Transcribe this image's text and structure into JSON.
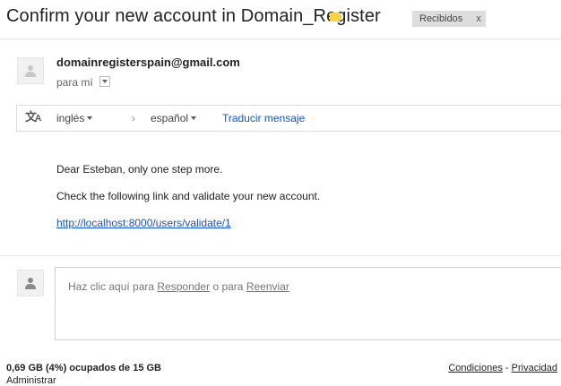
{
  "email": {
    "subject": "Confirm your new account in Domain_Register",
    "label_color": "#f8d24a",
    "inbox_chip": {
      "label": "Recibidos",
      "remove_symbol": "x"
    },
    "sender": "domainregisterspain@gmail.com",
    "to_line": "para mí"
  },
  "translate_bar": {
    "icon": "translate-icon",
    "from_language": "inglés",
    "arrow": "›",
    "to_language": "español",
    "translate_link": "Traducir mensaje"
  },
  "body": {
    "greeting": "Dear Esteban, only one step more.",
    "instruction": "Check the following link and validate your new account.",
    "link": "http://localhost:8000/users/validate/1"
  },
  "reply": {
    "prefix": "Haz clic aquí para ",
    "reply_link": "Responder",
    "middle": " o para ",
    "forward_link": "Reenviar"
  },
  "footer": {
    "storage": "0,69 GB (4%) ocupados de 15 GB",
    "manage": "Administrar",
    "terms": "Condiciones",
    "separator": " - ",
    "privacy": "Privacidad"
  },
  "colors": {
    "link": "#1155cc",
    "chip_bg": "#dddddd"
  }
}
